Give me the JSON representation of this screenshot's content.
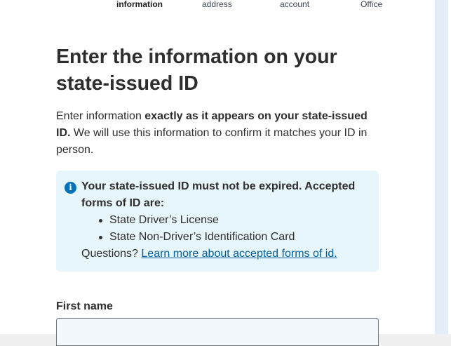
{
  "steps": [
    {
      "label": "information",
      "active": true
    },
    {
      "label": "address",
      "active": false
    },
    {
      "label": "account",
      "active": false
    },
    {
      "label": "Office",
      "active": false
    }
  ],
  "title": "Enter the information on your state-issued ID",
  "intro": {
    "prefix": "Enter information ",
    "emphasis": "exactly as it appears on your state-issued ID.",
    "suffix": " We will use this information to confirm it matches your ID in person."
  },
  "alert": {
    "icon": "info-icon",
    "heading": "Your state-issued ID must not be expired. Accepted forms of ID are:",
    "items": [
      "State Driver’s License",
      "State Non-Driver’s Identification Card"
    ],
    "questions_prefix": "Questions? ",
    "link_label": "Learn more about accepted forms of id."
  },
  "form": {
    "first_name_label": "First name",
    "first_name_value": ""
  },
  "colors": {
    "alert_bg": "#e7f6fb",
    "info_icon": "#0071bb",
    "link": "#005ea2"
  }
}
